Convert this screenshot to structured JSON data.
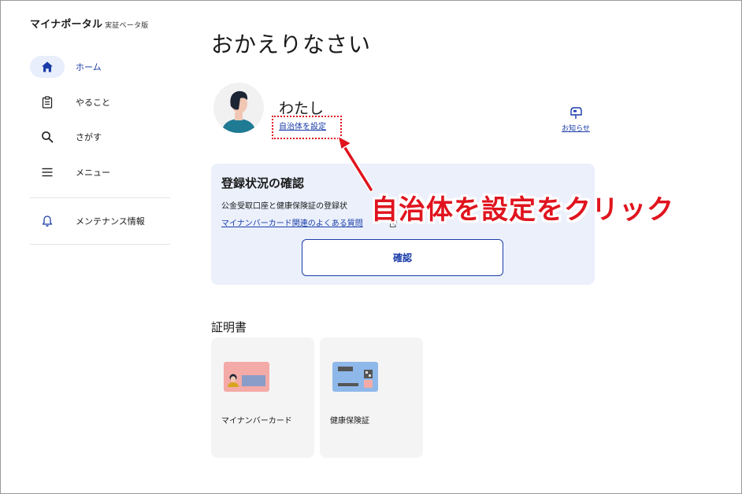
{
  "app": {
    "title": "マイナポータル",
    "subtitle": "実証ベータ版"
  },
  "sidebar": {
    "items": [
      {
        "label": "ホーム",
        "icon": "home-icon",
        "active": true
      },
      {
        "label": "やること",
        "icon": "clipboard-icon",
        "active": false
      },
      {
        "label": "さがす",
        "icon": "search-icon",
        "active": false
      },
      {
        "label": "メニュー",
        "icon": "menu-icon",
        "active": false
      }
    ],
    "maintenance": {
      "label": "メンテナンス情報",
      "icon": "bell-icon"
    }
  },
  "main": {
    "greeting": "おかえりなさい",
    "user": {
      "name": "わたし",
      "set_municipality_link": "自治体を設定"
    },
    "notice": {
      "label": "お知らせ",
      "icon": "mailbox-icon"
    },
    "registration_card": {
      "title": "登録状況の確認",
      "description": "公金受取口座と健康保険証の登録状",
      "faq_link": "マイナンバーカード関連のよくある質問",
      "confirm_button": "確認"
    },
    "certificates": {
      "title": "証明書",
      "items": [
        {
          "label": "マイナンバーカード",
          "icon": "mynumber-card-icon"
        },
        {
          "label": "健康保険証",
          "icon": "health-insurance-card-icon"
        }
      ]
    }
  },
  "annotation": {
    "text": "自治体を設定をクリック",
    "color": "#e0141e"
  },
  "colors": {
    "accent": "#1a3ca8",
    "card_background": "#ebf0fb",
    "active_nav_background": "#e8eefb"
  }
}
